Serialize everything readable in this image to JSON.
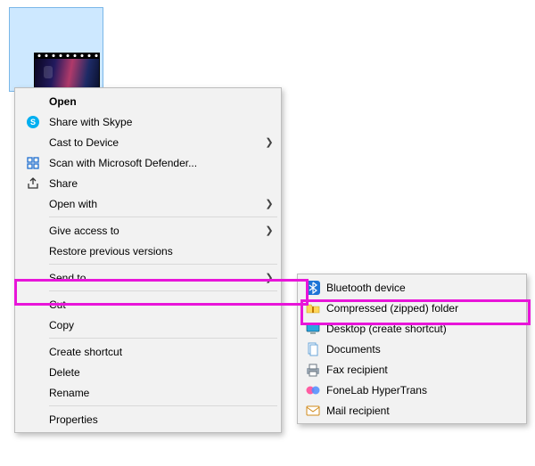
{
  "file": {
    "selected": true,
    "kind": "video"
  },
  "menu": {
    "open": "Open",
    "skype": "Share with Skype",
    "cast": "Cast to Device",
    "defender": "Scan with Microsoft Defender...",
    "share": "Share",
    "openwith": "Open with",
    "giveaccess": "Give access to",
    "restore": "Restore previous versions",
    "sendto": "Send to",
    "cut": "Cut",
    "copy": "Copy",
    "shortcut": "Create shortcut",
    "delete": "Delete",
    "rename": "Rename",
    "properties": "Properties"
  },
  "sendto_sub": {
    "bluetooth": "Bluetooth device",
    "zip": "Compressed (zipped) folder",
    "desktop": "Desktop (create shortcut)",
    "documents": "Documents",
    "fax": "Fax recipient",
    "fonelab": "FoneLab HyperTrans",
    "mail": "Mail recipient"
  },
  "highlight": {
    "sendto": true,
    "zip": true
  }
}
